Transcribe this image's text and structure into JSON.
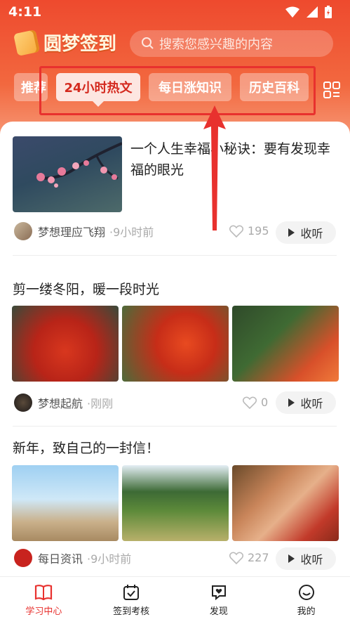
{
  "status_bar": {
    "time": "4:11"
  },
  "app": {
    "name": "圆梦签到"
  },
  "search": {
    "placeholder": "搜索您感兴趣的内容"
  },
  "tabs": [
    {
      "label": "推荐",
      "active": false
    },
    {
      "label": "24小时热文",
      "active": true
    },
    {
      "label": "每日涨知识",
      "active": false
    },
    {
      "label": "历史百科",
      "active": false
    }
  ],
  "feed": [
    {
      "title": "一个人生幸福小秘诀：要有发现幸福的眼光",
      "author": "梦想理应飞翔",
      "time": "·9小时前",
      "likes": "195",
      "listen_label": "收听"
    },
    {
      "title": "剪一缕冬阳，暖一段时光",
      "author": "梦想起航",
      "time": "·刚刚",
      "likes": "0",
      "listen_label": "收听"
    },
    {
      "title": "新年，致自己的一封信！",
      "author": "每日资讯",
      "time": "·9小时前",
      "likes": "227",
      "listen_label": "收听"
    }
  ],
  "bottom_nav": [
    {
      "label": "学习中心",
      "icon": "book-icon",
      "active": true
    },
    {
      "label": "签到考核",
      "icon": "calendar-check-icon",
      "active": false
    },
    {
      "label": "发现",
      "icon": "heart-chat-icon",
      "active": false
    },
    {
      "label": "我的",
      "icon": "smiley-icon",
      "active": false
    }
  ],
  "colors": {
    "accent": "#e8312e",
    "header": "#ee4a2e"
  }
}
